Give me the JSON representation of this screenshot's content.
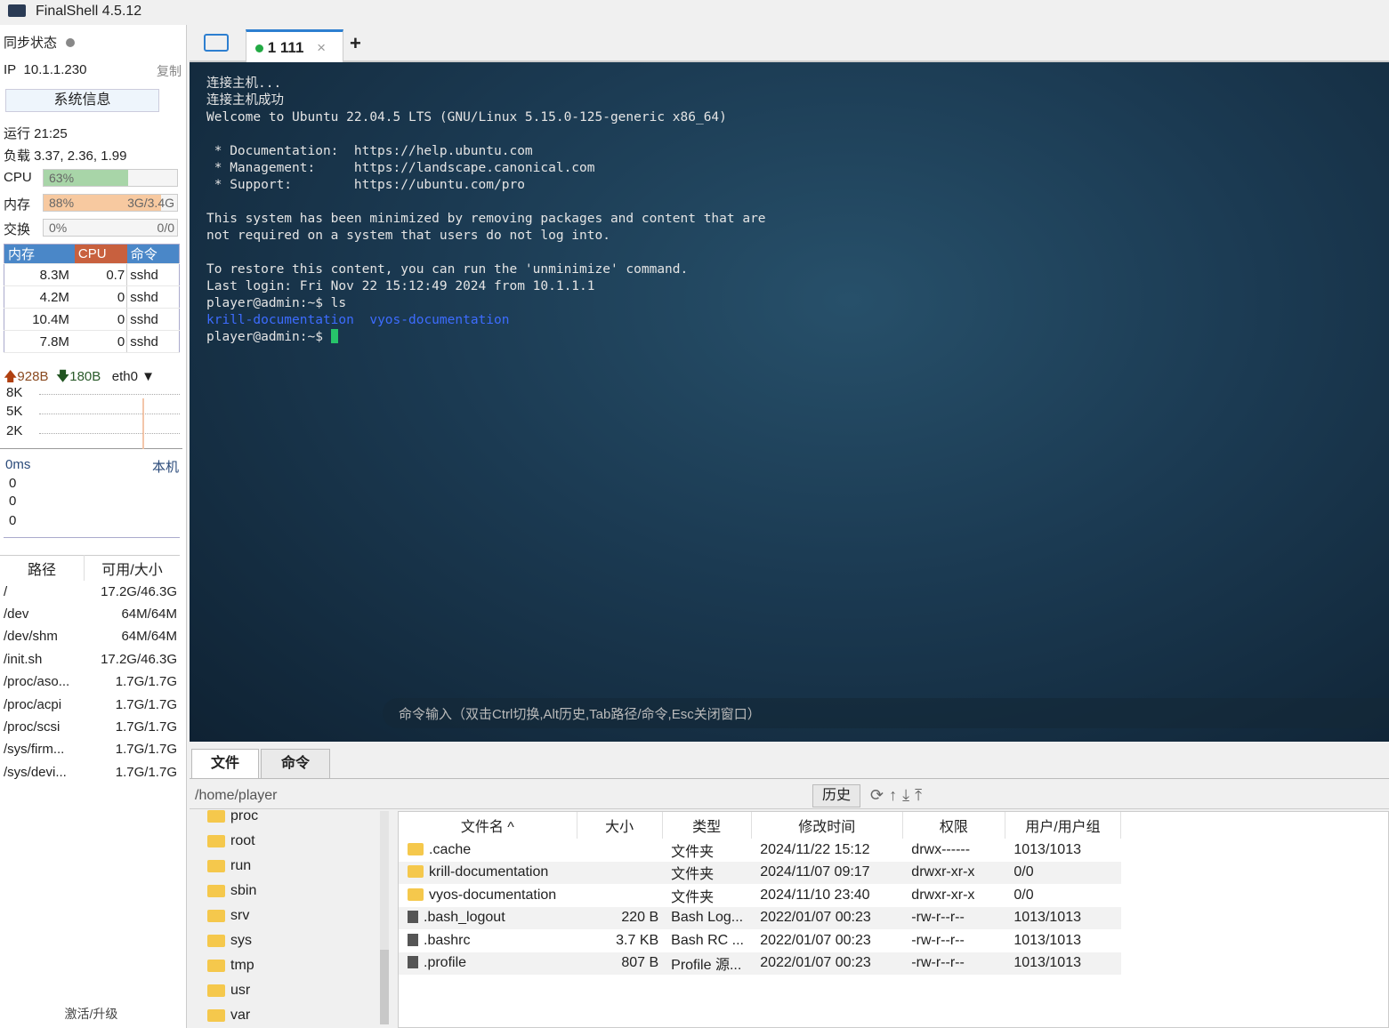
{
  "title": "FinalShell 4.5.12",
  "left": {
    "sync_label": "同步状态",
    "ip_label": "IP",
    "ip": "10.1.1.230",
    "copy": "复制",
    "sysinfo": "系统信息",
    "uptime": "运行 21:25",
    "load": "负载 3.37, 2.36, 1.99",
    "cpu": {
      "label": "CPU",
      "text": "63%",
      "percent": 63
    },
    "mem": {
      "label": "内存",
      "text": "88%",
      "size": "3G/3.4G",
      "percent": 88
    },
    "swap": {
      "label": "交换",
      "text": "0%",
      "size": "0/0",
      "percent": 0
    },
    "proc_headers": [
      "内存",
      "CPU",
      "命令"
    ],
    "procs": [
      [
        "8.3M",
        "0.7",
        "sshd"
      ],
      [
        "4.2M",
        "0",
        "sshd"
      ],
      [
        "10.4M",
        "0",
        "sshd"
      ],
      [
        "7.8M",
        "0",
        "sshd"
      ]
    ],
    "net": {
      "up": "928B",
      "down": "180B",
      "iface": "eth0",
      "ticks": [
        "8K",
        "5K",
        "2K"
      ]
    },
    "ping": {
      "ms": "0ms",
      "host": "本机",
      "ticks": [
        "0",
        "0",
        "0"
      ]
    },
    "disk_headers": [
      "路径",
      "可用/大小"
    ],
    "disks": [
      [
        "/",
        "17.2G/46.3G"
      ],
      [
        "/dev",
        "64M/64M"
      ],
      [
        "/dev/shm",
        "64M/64M"
      ],
      [
        "/init.sh",
        "17.2G/46.3G"
      ],
      [
        "/proc/aso...",
        "1.7G/1.7G"
      ],
      [
        "/proc/acpi",
        "1.7G/1.7G"
      ],
      [
        "/proc/scsi",
        "1.7G/1.7G"
      ],
      [
        "/sys/firm...",
        "1.7G/1.7G"
      ],
      [
        "/sys/devi...",
        "1.7G/1.7G"
      ]
    ],
    "activate": "激活/升级"
  },
  "tab": {
    "label": "1 111"
  },
  "terminal": {
    "lines": [
      "连接主机...",
      "连接主机成功",
      "Welcome to Ubuntu 22.04.5 LTS (GNU/Linux 5.15.0-125-generic x86_64)",
      "",
      " * Documentation:  https://help.ubuntu.com",
      " * Management:     https://landscape.canonical.com",
      " * Support:        https://ubuntu.com/pro",
      "",
      "This system has been minimized by removing packages and content that are",
      "not required on a system that users do not log into.",
      "",
      "To restore this content, you can run the 'unminimize' command.",
      "Last login: Fri Nov 22 15:12:49 2024 from 10.1.1.1",
      "player@admin:~$ ls"
    ],
    "ls_out": [
      "krill-documentation",
      "vyos-documentation"
    ],
    "prompt": "player@admin:~$ ",
    "cmd_hint": "命令输入（双击Ctrl切换,Alt历史,Tab路径/命令,Esc关闭窗口）"
  },
  "bottom": {
    "tabs": [
      "文件",
      "命令"
    ],
    "path": "/home/player",
    "history": "历史",
    "tree": [
      "proc",
      "root",
      "run",
      "sbin",
      "srv",
      "sys",
      "tmp",
      "usr",
      "var"
    ],
    "headers": [
      "文件名 ^",
      "大小",
      "类型",
      "修改时间",
      "权限",
      "用户/用户组"
    ],
    "files": [
      {
        "name": ".cache",
        "size": "",
        "type": "文件夹",
        "mtime": "2024/11/22 15:12",
        "perm": "drwx------",
        "owner": "1013/1013",
        "dir": true
      },
      {
        "name": "krill-documentation",
        "size": "",
        "type": "文件夹",
        "mtime": "2024/11/07 09:17",
        "perm": "drwxr-xr-x",
        "owner": "0/0",
        "dir": true
      },
      {
        "name": "vyos-documentation",
        "size": "",
        "type": "文件夹",
        "mtime": "2024/11/10 23:40",
        "perm": "drwxr-xr-x",
        "owner": "0/0",
        "dir": true
      },
      {
        "name": ".bash_logout",
        "size": "220 B",
        "type": "Bash Log...",
        "mtime": "2022/01/07 00:23",
        "perm": "-rw-r--r--",
        "owner": "1013/1013",
        "dir": false
      },
      {
        "name": ".bashrc",
        "size": "3.7 KB",
        "type": "Bash RC ...",
        "mtime": "2022/01/07 00:23",
        "perm": "-rw-r--r--",
        "owner": "1013/1013",
        "dir": false
      },
      {
        "name": ".profile",
        "size": "807 B",
        "type": "Profile 源...",
        "mtime": "2022/01/07 00:23",
        "perm": "-rw-r--r--",
        "owner": "1013/1013",
        "dir": false
      }
    ]
  }
}
